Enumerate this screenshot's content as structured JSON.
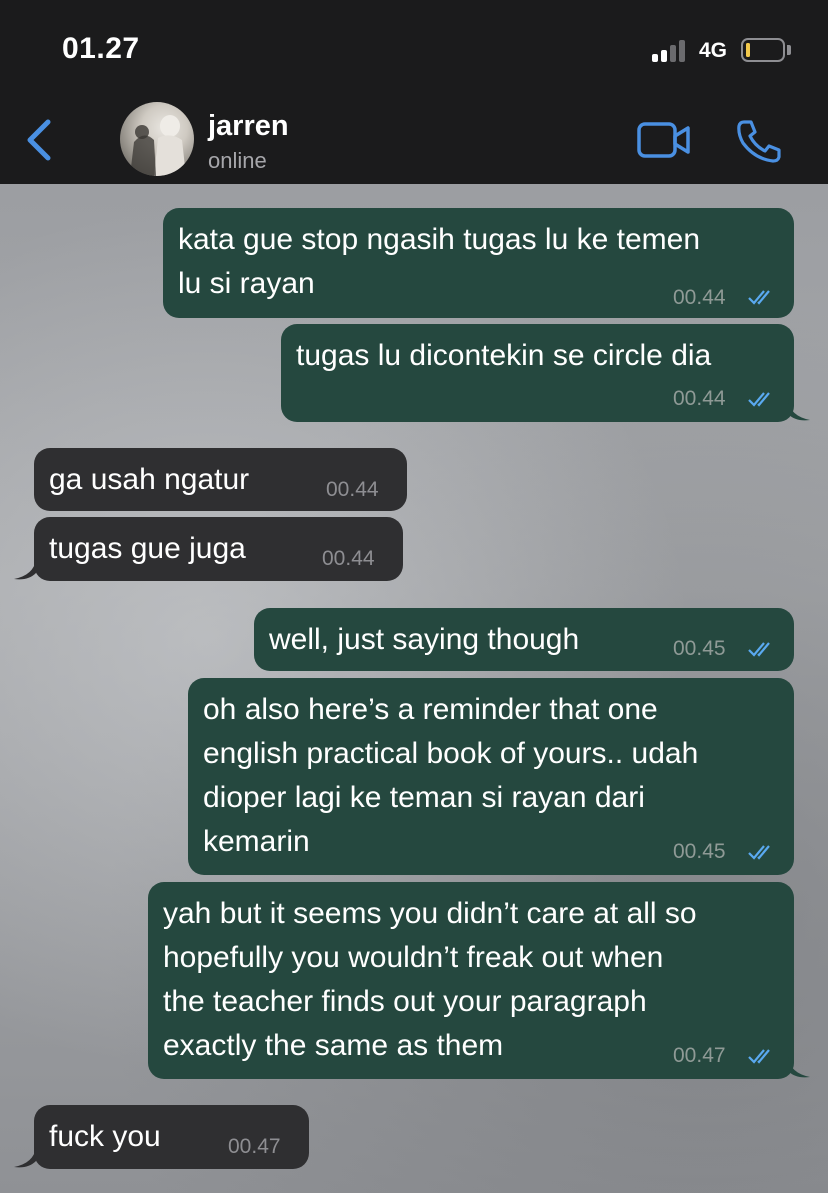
{
  "status_bar": {
    "time": "01.27",
    "network": "4G",
    "battery_level": 0.1,
    "signal_bars_active": 2,
    "signal_bars_total": 4
  },
  "header": {
    "contact_name": "jarren",
    "contact_status": "online",
    "icons": [
      "chevron-left-icon",
      "video-camera-icon",
      "phone-icon"
    ],
    "accent_color": "#4a90e2"
  },
  "messages": [
    {
      "direction": "outgoing",
      "lines": [
        "kata gue stop ngasih tugas lu ke temen",
        "lu si rayan"
      ],
      "time": "00.44",
      "read": true
    },
    {
      "direction": "outgoing",
      "lines": [
        "tugas lu dicontekin se circle dia"
      ],
      "time": "00.44",
      "read": true
    },
    {
      "direction": "incoming",
      "lines": [
        "ga usah ngatur"
      ],
      "time": "00.44"
    },
    {
      "direction": "incoming",
      "lines": [
        "tugas gue juga"
      ],
      "time": "00.44"
    },
    {
      "direction": "outgoing",
      "lines": [
        "well, just saying though"
      ],
      "time": "00.45",
      "read": true
    },
    {
      "direction": "outgoing",
      "lines": [
        "oh also here’s a reminder that one",
        "english practical book of yours.. udah",
        "dioper lagi ke teman si rayan dari",
        "kemarin"
      ],
      "time": "00.45",
      "read": true
    },
    {
      "direction": "outgoing",
      "lines": [
        "yah but it seems you didn’t care at all so",
        "hopefully you wouldn’t freak out when",
        "the teacher finds out your paragraph",
        "exactly the same as them"
      ],
      "time": "00.47",
      "read": true
    },
    {
      "direction": "incoming",
      "lines": [
        "fuck you"
      ],
      "time": "00.47"
    }
  ],
  "colors": {
    "outgoing_bubble": "#25483f",
    "incoming_bubble": "#2f2f31",
    "read_tick": "#5aa9f0"
  }
}
